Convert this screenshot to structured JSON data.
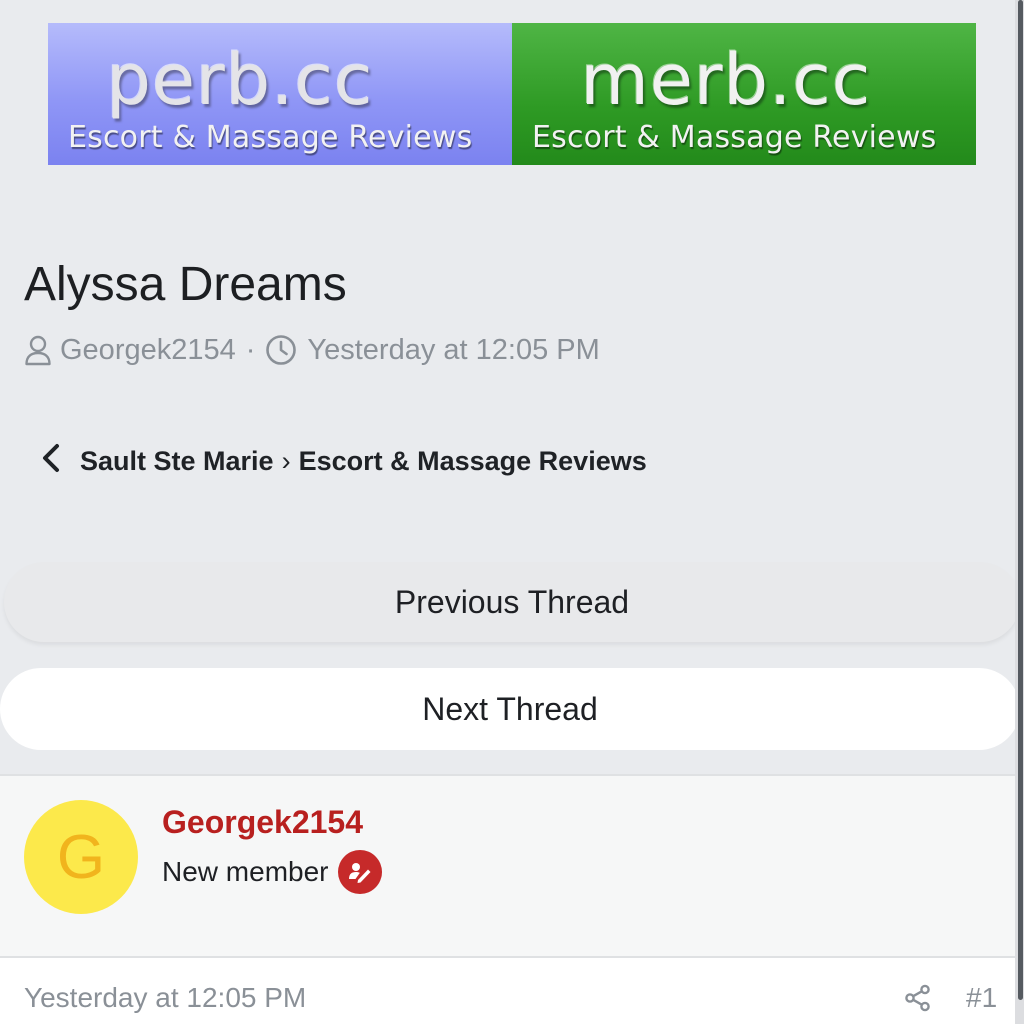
{
  "banner": {
    "left_logo": "perb.cc",
    "left_tagline": "Escort & Massage Reviews",
    "right_logo": "merb.cc",
    "right_tagline": "Escort & Massage Reviews"
  },
  "thread": {
    "title": "Alyssa Dreams",
    "author": "Georgek2154",
    "separator": "·",
    "time": "Yesterday at 12:05 PM"
  },
  "breadcrumb": {
    "parent": "Sault Ste Marie",
    "separator": "›",
    "current": "Escort & Massage Reviews"
  },
  "navigation": {
    "previous_label": "Previous Thread",
    "next_label": "Next Thread"
  },
  "post": {
    "avatar_letter": "G",
    "username": "Georgek2154",
    "member_title": "New member",
    "date": "Yesterday at 12:05 PM",
    "number": "#1"
  },
  "colors": {
    "username": "#b8201f",
    "avatar_bg": "#fce94b",
    "avatar_letter": "#f1b41d",
    "badge": "#c62a2a",
    "perb_banner": "#8f96f6",
    "merb_banner": "#2e9a24"
  },
  "icons": {
    "author": "user-icon",
    "time": "clock-icon",
    "back": "chevron-left-icon",
    "badge": "member-badge-icon",
    "share": "share-icon"
  }
}
